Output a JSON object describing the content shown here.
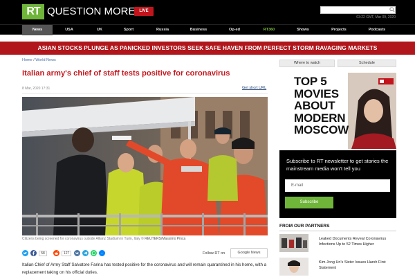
{
  "header": {
    "logo_text": "RT",
    "slogan": "QUESTION MORE",
    "live_label": "LIVE",
    "datetime": "03:22 GMT, Mar 09, 2020"
  },
  "nav": {
    "items": [
      "News",
      "USA",
      "UK",
      "Sport",
      "Russia",
      "Business",
      "Op-ed",
      "RT360",
      "Shows",
      "Projects",
      "Podcasts"
    ]
  },
  "breaking": "ASIAN STOCKS PLUNGE AS PANICKED INVESTORS SEEK SAFE HAVEN FROM PERFECT STORM RAVAGING MARKETS",
  "breadcrumb": {
    "home": "Home",
    "sep": " / ",
    "section": "World News"
  },
  "article": {
    "title": "Italian army's chief of staff tests positive for coronavirus",
    "date": "8 Mar, 2020 17:31",
    "short_url": "Get short URL",
    "caption_text": "Citizens being screened for coronavirus outside Allianz Stadium in Turin, Italy ©",
    "caption_credit": "REUTERS/Massimo Pinca",
    "share_counts": {
      "facebook": "58",
      "reddit": "127"
    },
    "follow_label": "Follow RT on",
    "gnews_label": "Google News",
    "body": "Italian Chief of Army Staff Salvatore Farina has tested positive for the coronavirus and will remain quarantined in his home, with a replacement taking on his official duties."
  },
  "sidebar": {
    "tabs": [
      "Where to watch",
      "Schedule"
    ],
    "promo_title_lines": [
      "TOP 5",
      "MOVIES",
      "ABOUT",
      "MODERN",
      "MOSCOW"
    ],
    "newsletter_text": "Subscribe to RT newsletter to get stories the mainstream media won't tell you",
    "newsletter_placeholder": "E-mail",
    "subscribe_label": "Subscribe",
    "partners_heading": "FROM OUR PARTNERS",
    "partners": [
      {
        "title": "Leaked Documents Reveal Coronavirus Infections Up to 52 Times Higher"
      },
      {
        "title": "Kim Jong Un's Sister Issues Harsh First Statement"
      }
    ]
  },
  "colors": {
    "brand_green": "#6fb53a",
    "headline_red": "#c6181e",
    "banner_red": "#b0161b",
    "live_red": "#c1141c"
  },
  "icons": [
    "search-icon",
    "twitter-icon",
    "facebook-icon",
    "reddit-icon",
    "vk-icon",
    "telegram-icon",
    "whatsapp-icon",
    "messenger-icon"
  ]
}
